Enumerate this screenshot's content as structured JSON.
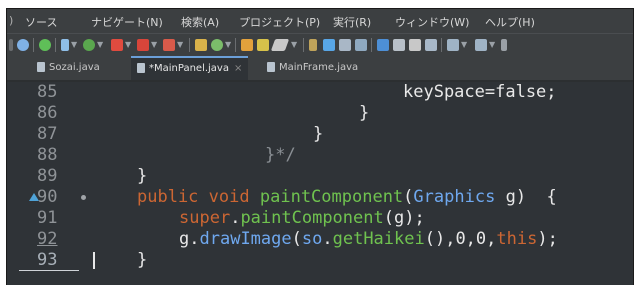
{
  "menu": {
    "items": [
      "ソース",
      "ナビゲート(N)",
      "検索(A)",
      "プロジェクト(P)",
      "実行(R)",
      "ウィンドウ(W)",
      "ヘルプ(H)"
    ]
  },
  "tabs": [
    {
      "label": "Sozai.java",
      "active": false
    },
    {
      "label": "*MainPanel.java",
      "active": true,
      "close": "×"
    },
    {
      "label": "MainFrame.java",
      "active": false
    }
  ],
  "editor": {
    "line_numbers": [
      "85",
      "86",
      "87",
      "88",
      "89",
      "90",
      "91",
      "92",
      "93"
    ],
    "folded_marker_line": "90",
    "code": {
      "l85": "keySpace=false;",
      "l86_brace": "}",
      "l87_brace": "}",
      "l88_comment": "}*/",
      "l89_brace": "}",
      "l90_kw1": "public",
      "l90_kw2": "void",
      "l90_method": "paintComponent",
      "l90_paren": "(",
      "l90_type": "Graphics",
      "l90_param": "g",
      "l90_close": ")",
      "l90_brace": "{",
      "l91_kw": "super",
      "l91_dot": ".",
      "l91_method": "paintComponent",
      "l91_rest": "(g);",
      "l92_obj": "g",
      "l92_dot": ".",
      "l92_method": "drawImage",
      "l92_paren": "(",
      "l92_so": "so",
      "l92_dot2": ".",
      "l92_getter": "getHaikei",
      "l92_args": "(),0,0,",
      "l92_this": "this",
      "l92_end": ");",
      "l93_brace": "}"
    }
  },
  "colors": {
    "editor_bg": "#2f3337",
    "keyword": "#cc6633",
    "method": "#6fc24f",
    "type": "#6fa8ef",
    "line_marker": "#4fa3d8"
  }
}
